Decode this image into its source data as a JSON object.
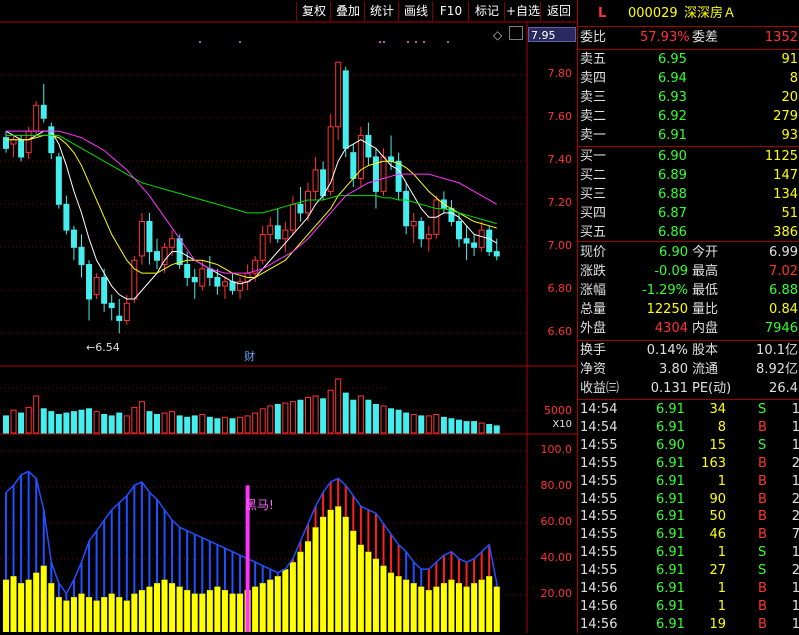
{
  "toolbar": [
    "复权",
    "叠加",
    "统计",
    "画线",
    "F10",
    "标记",
    "+自选",
    "返回"
  ],
  "stock": {
    "marker": "L",
    "code": "000029",
    "name": "深深房Ａ"
  },
  "price_axis": {
    "current": "7.95",
    "ticks": [
      "7.80",
      "7.60",
      "7.40",
      "7.20",
      "7.00",
      "6.80",
      "6.60"
    ],
    "low_label": "6.54",
    "event_label": "财"
  },
  "volume_axis": {
    "tick": "5000",
    "scale": "X10"
  },
  "indicator_axis": {
    "ticks": [
      "100.0",
      "80.00",
      "60.00",
      "40.00",
      "20.00"
    ],
    "signal_label": "黑马!"
  },
  "weibi": {
    "label": "委比",
    "value": "57.93%",
    "label2": "委差",
    "value2": "1352"
  },
  "asks": [
    {
      "label": "卖五",
      "price": "6.95",
      "vol": "91"
    },
    {
      "label": "卖四",
      "price": "6.94",
      "vol": "8"
    },
    {
      "label": "卖三",
      "price": "6.93",
      "vol": "20"
    },
    {
      "label": "卖二",
      "price": "6.92",
      "vol": "279"
    },
    {
      "label": "卖一",
      "price": "6.91",
      "vol": "93"
    }
  ],
  "bids": [
    {
      "label": "买一",
      "price": "6.90",
      "vol": "1125"
    },
    {
      "label": "买二",
      "price": "6.89",
      "vol": "147"
    },
    {
      "label": "买三",
      "price": "6.88",
      "vol": "134"
    },
    {
      "label": "买四",
      "price": "6.87",
      "vol": "51"
    },
    {
      "label": "买五",
      "price": "6.86",
      "vol": "386"
    }
  ],
  "quote": [
    {
      "l1": "现价",
      "v1": "6.90",
      "c1": "green",
      "l2": "今开",
      "v2": "6.99",
      "c2": "white"
    },
    {
      "l1": "涨跌",
      "v1": "-0.09",
      "c1": "green",
      "l2": "最高",
      "v2": "7.02",
      "c2": "red"
    },
    {
      "l1": "涨幅",
      "v1": "-1.29%",
      "c1": "green",
      "l2": "最低",
      "v2": "6.88",
      "c2": "green"
    },
    {
      "l1": "总量",
      "v1": "12250",
      "c1": "yellow",
      "l2": "量比",
      "v2": "0.84",
      "c2": "yellow"
    },
    {
      "l1": "外盘",
      "v1": "4304",
      "c1": "red",
      "l2": "内盘",
      "v2": "7946",
      "c2": "green"
    }
  ],
  "fundamentals": [
    {
      "l1": "换手",
      "v1": "0.14%",
      "l2": "股本",
      "v2": "10.1亿"
    },
    {
      "l1": "净资",
      "v1": "3.80",
      "l2": "流通",
      "v2": "8.92亿"
    },
    {
      "l1": "收益㈢",
      "v1": "0.131",
      "l2": "PE(动)",
      "v2": "26.4"
    }
  ],
  "ticks": [
    {
      "t": "14:54",
      "p": "6.91",
      "v": "34",
      "d": "S",
      "n": "1"
    },
    {
      "t": "14:54",
      "p": "6.91",
      "v": "8",
      "d": "B",
      "n": "1"
    },
    {
      "t": "14:55",
      "p": "6.90",
      "v": "15",
      "d": "S",
      "n": "1"
    },
    {
      "t": "14:55",
      "p": "6.91",
      "v": "163",
      "d": "B",
      "n": "2"
    },
    {
      "t": "14:55",
      "p": "6.91",
      "v": "1",
      "d": "B",
      "n": "1"
    },
    {
      "t": "14:55",
      "p": "6.91",
      "v": "90",
      "d": "B",
      "n": "2"
    },
    {
      "t": "14:55",
      "p": "6.91",
      "v": "50",
      "d": "B",
      "n": "2"
    },
    {
      "t": "14:55",
      "p": "6.91",
      "v": "46",
      "d": "B",
      "n": "7"
    },
    {
      "t": "14:55",
      "p": "6.91",
      "v": "1",
      "d": "S",
      "n": "1"
    },
    {
      "t": "14:55",
      "p": "6.91",
      "v": "27",
      "d": "S",
      "n": "2"
    },
    {
      "t": "14:56",
      "p": "6.91",
      "v": "1",
      "d": "B",
      "n": "1"
    },
    {
      "t": "14:56",
      "p": "6.91",
      "v": "1",
      "d": "B",
      "n": "1"
    },
    {
      "t": "14:56",
      "p": "6.91",
      "v": "19",
      "d": "B",
      "n": "1"
    }
  ],
  "chart_data": {
    "type": "candlestick",
    "price_range": [
      6.5,
      7.95
    ],
    "candles": [
      [
        7.45,
        7.48,
        7.38,
        7.4
      ],
      [
        7.42,
        7.46,
        7.36,
        7.44
      ],
      [
        7.44,
        7.46,
        7.34,
        7.36
      ],
      [
        7.38,
        7.5,
        7.35,
        7.48
      ],
      [
        7.48,
        7.62,
        7.46,
        7.6
      ],
      [
        7.6,
        7.7,
        7.52,
        7.54
      ],
      [
        7.5,
        7.52,
        7.35,
        7.38
      ],
      [
        7.36,
        7.38,
        7.12,
        7.14
      ],
      [
        7.14,
        7.18,
        7.0,
        7.02
      ],
      [
        7.02,
        7.04,
        6.88,
        6.94
      ],
      [
        6.94,
        7.0,
        6.8,
        6.86
      ],
      [
        6.86,
        6.88,
        6.6,
        6.7
      ],
      [
        6.72,
        6.82,
        6.7,
        6.8
      ],
      [
        6.8,
        6.84,
        6.64,
        6.68
      ],
      [
        6.68,
        6.72,
        6.6,
        6.66
      ],
      [
        6.62,
        6.7,
        6.54,
        6.6
      ],
      [
        6.6,
        6.72,
        6.58,
        6.68
      ],
      [
        6.7,
        6.9,
        6.68,
        6.88
      ],
      [
        6.9,
        7.1,
        6.86,
        7.06
      ],
      [
        7.06,
        7.1,
        6.86,
        6.92
      ],
      [
        6.92,
        6.98,
        6.84,
        6.88
      ],
      [
        6.86,
        6.96,
        6.82,
        6.94
      ],
      [
        6.94,
        7.02,
        6.9,
        6.98
      ],
      [
        6.98,
        7.0,
        6.84,
        6.86
      ],
      [
        6.86,
        6.92,
        6.76,
        6.8
      ],
      [
        6.8,
        6.84,
        6.7,
        6.78
      ],
      [
        6.76,
        6.88,
        6.74,
        6.84
      ],
      [
        6.84,
        6.9,
        6.76,
        6.8
      ],
      [
        6.8,
        6.84,
        6.72,
        6.76
      ],
      [
        6.76,
        6.8,
        6.7,
        6.78
      ],
      [
        6.78,
        6.82,
        6.72,
        6.74
      ],
      [
        6.74,
        6.8,
        6.7,
        6.78
      ],
      [
        6.78,
        6.86,
        6.74,
        6.82
      ],
      [
        6.82,
        6.9,
        6.78,
        6.88
      ],
      [
        6.88,
        7.04,
        6.86,
        7.0
      ],
      [
        7.0,
        7.08,
        6.96,
        7.04
      ],
      [
        7.04,
        7.12,
        6.96,
        6.98
      ],
      [
        6.98,
        7.06,
        6.92,
        7.02
      ],
      [
        7.02,
        7.18,
        7.0,
        7.14
      ],
      [
        7.14,
        7.22,
        7.06,
        7.1
      ],
      [
        7.1,
        7.24,
        7.06,
        7.2
      ],
      [
        7.2,
        7.36,
        7.16,
        7.3
      ],
      [
        7.3,
        7.34,
        7.16,
        7.18
      ],
      [
        7.2,
        7.56,
        7.18,
        7.5
      ],
      [
        7.5,
        7.8,
        7.44,
        7.8
      ],
      [
        7.76,
        7.78,
        7.36,
        7.4
      ],
      [
        7.38,
        7.42,
        7.22,
        7.26
      ],
      [
        7.26,
        7.5,
        7.22,
        7.46
      ],
      [
        7.46,
        7.52,
        7.32,
        7.36
      ],
      [
        7.36,
        7.4,
        7.12,
        7.2
      ],
      [
        7.2,
        7.4,
        7.18,
        7.36
      ],
      [
        7.36,
        7.46,
        7.3,
        7.34
      ],
      [
        7.34,
        7.38,
        7.16,
        7.2
      ],
      [
        7.2,
        7.24,
        7.0,
        7.04
      ],
      [
        7.04,
        7.1,
        6.96,
        7.06
      ],
      [
        7.06,
        7.08,
        6.94,
        6.98
      ],
      [
        6.98,
        7.04,
        6.92,
        7.0
      ],
      [
        7.0,
        7.18,
        6.98,
        7.16
      ],
      [
        7.16,
        7.2,
        7.1,
        7.12
      ],
      [
        7.12,
        7.16,
        7.04,
        7.06
      ],
      [
        7.06,
        7.1,
        6.94,
        6.98
      ],
      [
        6.98,
        7.04,
        6.88,
        6.96
      ],
      [
        6.96,
        7.0,
        6.9,
        6.94
      ],
      [
        6.94,
        7.06,
        6.92,
        7.02
      ],
      [
        7.02,
        7.04,
        6.9,
        6.92
      ],
      [
        6.92,
        6.98,
        6.88,
        6.9
      ]
    ],
    "ma": [
      {
        "color": "#ffffff",
        "values": [
          7.48,
          7.46,
          7.44,
          7.44,
          7.46,
          7.48,
          7.48,
          7.42,
          7.32,
          7.2,
          7.1,
          6.98,
          6.88,
          6.82,
          6.76,
          6.72,
          6.7,
          6.7,
          6.74,
          6.78,
          6.82,
          6.88,
          6.92,
          6.92,
          6.9,
          6.88,
          6.86,
          6.84,
          6.82,
          6.8,
          6.78,
          6.77,
          6.78,
          6.8,
          6.84,
          6.88,
          6.92,
          6.96,
          7.0,
          7.04,
          7.08,
          7.14,
          7.18,
          7.24,
          7.34,
          7.4,
          7.42,
          7.44,
          7.42,
          7.4,
          7.36,
          7.32,
          7.3,
          7.24,
          7.18,
          7.12,
          7.08,
          7.08,
          7.1,
          7.1,
          7.08,
          7.04,
          7.0,
          6.99,
          6.98,
          6.96
        ]
      },
      {
        "color": "#ffff00",
        "values": [
          7.44,
          7.44,
          7.44,
          7.44,
          7.45,
          7.46,
          7.46,
          7.45,
          7.42,
          7.38,
          7.32,
          7.24,
          7.16,
          7.08,
          7.0,
          6.94,
          6.88,
          6.84,
          6.82,
          6.82,
          6.82,
          6.84,
          6.86,
          6.87,
          6.88,
          6.88,
          6.88,
          6.87,
          6.86,
          6.84,
          6.82,
          6.81,
          6.8,
          6.8,
          6.82,
          6.84,
          6.86,
          6.88,
          6.92,
          6.96,
          7.0,
          7.04,
          7.08,
          7.12,
          7.18,
          7.22,
          7.26,
          7.3,
          7.32,
          7.33,
          7.34,
          7.34,
          7.33,
          7.31,
          7.28,
          7.24,
          7.2,
          7.17,
          7.14,
          7.12,
          7.1,
          7.08,
          7.06,
          7.05,
          7.04,
          7.03
        ]
      },
      {
        "color": "#00dd00",
        "values": [
          7.46,
          7.46,
          7.46,
          7.46,
          7.46,
          7.46,
          7.46,
          7.46,
          7.44,
          7.42,
          7.4,
          7.38,
          7.36,
          7.34,
          7.32,
          7.3,
          7.28,
          7.26,
          7.24,
          7.23,
          7.22,
          7.21,
          7.2,
          7.19,
          7.18,
          7.17,
          7.16,
          7.15,
          7.14,
          7.13,
          7.12,
          7.11,
          7.1,
          7.1,
          7.1,
          7.11,
          7.12,
          7.13,
          7.14,
          7.15,
          7.16,
          7.16,
          7.16,
          7.17,
          7.18,
          7.18,
          7.18,
          7.18,
          7.18,
          7.18,
          7.17,
          7.17,
          7.16,
          7.16,
          7.15,
          7.14,
          7.13,
          7.12,
          7.12,
          7.11,
          7.1,
          7.09,
          7.08,
          7.07,
          7.06,
          7.05
        ]
      },
      {
        "color": "#ff33ff",
        "values": [
          7.48,
          7.48,
          7.48,
          7.48,
          7.48,
          7.48,
          7.48,
          7.48,
          7.47,
          7.46,
          7.45,
          7.43,
          7.41,
          7.39,
          7.36,
          7.33,
          7.3,
          7.26,
          7.22,
          7.18,
          7.13,
          7.08,
          7.03,
          6.98,
          6.93,
          6.88,
          6.86,
          6.84,
          6.83,
          6.82,
          6.82,
          6.82,
          6.82,
          6.83,
          6.84,
          6.86,
          6.88,
          6.9,
          6.92,
          6.95,
          6.98,
          7.02,
          7.06,
          7.1,
          7.14,
          7.18,
          7.2,
          7.22,
          7.24,
          7.25,
          7.26,
          7.27,
          7.28,
          7.28,
          7.28,
          7.28,
          7.28,
          7.27,
          7.26,
          7.25,
          7.24,
          7.22,
          7.2,
          7.18,
          7.16,
          7.14
        ]
      }
    ],
    "volumes": [
      120,
      160,
      140,
      180,
      260,
      170,
      150,
      130,
      140,
      150,
      160,
      170,
      150,
      130,
      120,
      140,
      120,
      180,
      220,
      150,
      130,
      140,
      150,
      120,
      110,
      120,
      130,
      110,
      100,
      110,
      100,
      110,
      120,
      140,
      170,
      190,
      200,
      210,
      220,
      230,
      250,
      260,
      240,
      300,
      380,
      280,
      230,
      260,
      230,
      200,
      190,
      170,
      160,
      140,
      130,
      120,
      120,
      130,
      110,
      100,
      90,
      80,
      80,
      70,
      60,
      50
    ],
    "indicator": {
      "line": [
        80,
        84,
        90,
        92,
        88,
        70,
        40,
        28,
        22,
        30,
        40,
        52,
        58,
        64,
        70,
        74,
        78,
        84,
        86,
        80,
        76,
        70,
        64,
        60,
        58,
        56,
        54,
        52,
        50,
        48,
        46,
        44,
        42,
        40,
        38,
        36,
        34,
        36,
        42,
        52,
        62,
        72,
        80,
        86,
        88,
        84,
        78,
        72,
        70,
        68,
        62,
        56,
        50,
        46,
        40,
        36,
        36,
        40,
        44,
        46,
        42,
        40,
        42,
        46,
        50,
        28
      ],
      "bars": [
        30,
        32,
        28,
        30,
        34,
        38,
        28,
        20,
        18,
        20,
        22,
        20,
        18,
        20,
        22,
        20,
        18,
        22,
        24,
        26,
        28,
        30,
        28,
        26,
        24,
        22,
        22,
        24,
        26,
        24,
        22,
        22,
        24,
        26,
        28,
        30,
        32,
        36,
        40,
        46,
        52,
        60,
        66,
        70,
        72,
        66,
        58,
        50,
        46,
        42,
        38,
        34,
        32,
        30,
        28,
        26,
        24,
        26,
        28,
        30,
        28,
        26,
        28,
        30,
        32,
        26
      ],
      "signal_index": 23,
      "range": [
        0,
        110
      ]
    }
  }
}
